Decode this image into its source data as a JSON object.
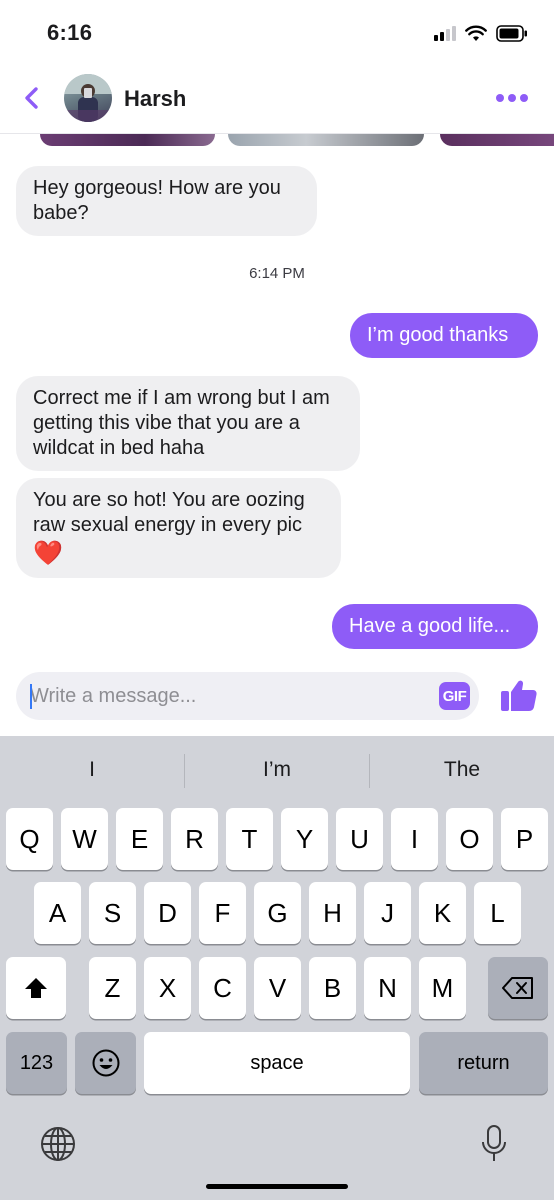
{
  "status_bar": {
    "time": "6:16"
  },
  "header": {
    "contact_name": "Harsh"
  },
  "messages": [
    {
      "direction": "in",
      "text": "Hey gorgeous! How are you babe?"
    },
    {
      "type": "timestamp",
      "text": "6:14 PM"
    },
    {
      "direction": "out",
      "text": "I’m good thanks"
    },
    {
      "direction": "in",
      "text": "Correct me if I am wrong but I am getting this vibe that you are a wildcat in bed haha"
    },
    {
      "direction": "in",
      "text": "You are so hot! You are oozing raw sexual energy in every pic",
      "emoji": "❤️"
    },
    {
      "direction": "out",
      "text": "Have a good life..."
    }
  ],
  "composer": {
    "placeholder": "Write a message...",
    "gif_label": "GIF"
  },
  "keyboard": {
    "suggestions": [
      "I",
      "I’m",
      "The"
    ],
    "row1": [
      "Q",
      "W",
      "E",
      "R",
      "T",
      "Y",
      "U",
      "I",
      "O",
      "P"
    ],
    "row2": [
      "A",
      "S",
      "D",
      "F",
      "G",
      "H",
      "J",
      "K",
      "L"
    ],
    "row3": [
      "Z",
      "X",
      "C",
      "V",
      "B",
      "N",
      "M"
    ],
    "numbers_key": "123",
    "space_key": "space",
    "return_key": "return"
  },
  "colors": {
    "accent": "#8e5cf7",
    "incoming_bubble": "#efeff1",
    "keyboard_bg": "#d1d3d9"
  },
  "icons": [
    "back-chevron-icon",
    "more-dots-icon",
    "thumbs-up-icon",
    "shift-icon",
    "delete-icon",
    "emoji-icon",
    "globe-icon",
    "microphone-icon"
  ]
}
